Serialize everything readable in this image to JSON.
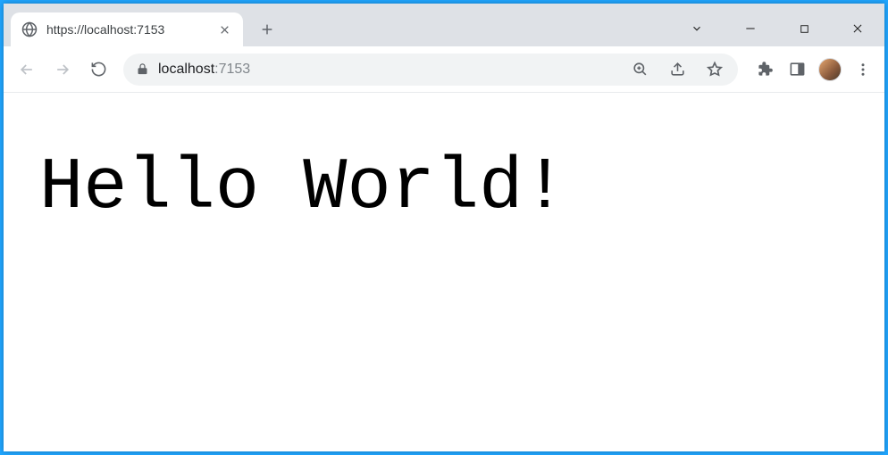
{
  "window": {
    "tab_title": "https://localhost:7153"
  },
  "toolbar": {
    "url_host": "localhost",
    "url_port": ":7153"
  },
  "page": {
    "body_text": "Hello World!"
  }
}
